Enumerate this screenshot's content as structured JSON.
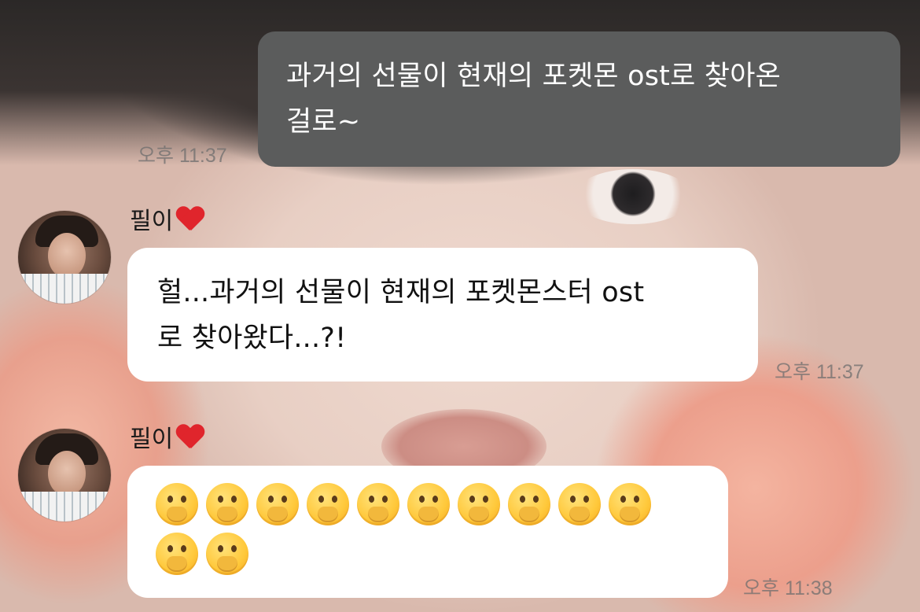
{
  "messages": [
    {
      "sender": "me",
      "lines": [
        "과거의 선물이 현재의 포켓몬 ost로 찾아온",
        "걸로~"
      ],
      "time": "오후 11:37"
    },
    {
      "sender": "other",
      "name": "필이",
      "name_icon": "red-heart-icon",
      "lines": [
        "헐...과거의 선물이 현재의 포켓몬스터 ost",
        "로 찾아왔다...?!"
      ],
      "time": "오후 11:37"
    },
    {
      "sender": "other",
      "name": "필이",
      "name_icon": "red-heart-icon",
      "emoji": "face-with-hand-over-mouth-icon",
      "emoji_count": 12,
      "time": "오후 11:38"
    }
  ],
  "colors": {
    "my_bubble": "#5b5c5c",
    "other_bubble": "#ffffff",
    "heart": "#e0252c",
    "timestamp": "#6e6e6e"
  }
}
